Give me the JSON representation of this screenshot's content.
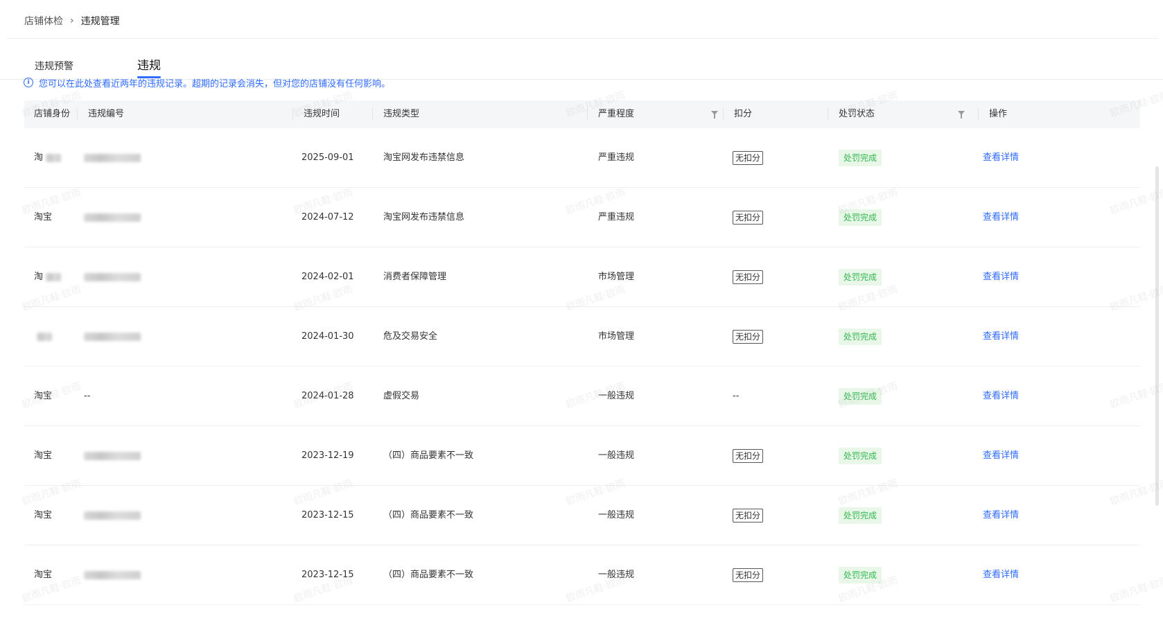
{
  "breadcrumb": {
    "parent": "店铺体检",
    "separator": "›",
    "current": "违规管理"
  },
  "tabs": [
    {
      "label": "违规预警",
      "active": false
    },
    {
      "label": "违规",
      "active": true
    }
  ],
  "notice": {
    "text": "您可以在此处查看近两年的违规记录。超期的记录会消失，但对您的店铺没有任何影响。"
  },
  "table": {
    "headers": {
      "shop_identity": "店铺身份",
      "violation_id": "违规编号",
      "violation_time": "违规时间",
      "violation_type": "违规类型",
      "severity": "严重程度",
      "deduction": "扣分",
      "penalty_status": "处罚状态",
      "action": "操作"
    },
    "rows": [
      {
        "shop": "淘",
        "shop_blur": true,
        "id": "",
        "id_blur": true,
        "time": "2025-09-01",
        "type": "淘宝网发布违禁信息",
        "severity": "严重违规",
        "deduction": "无扣分",
        "status": "处罚完成",
        "action": "查看详情"
      },
      {
        "shop": "淘宝",
        "shop_blur": false,
        "id": "",
        "id_blur": true,
        "time": "2024-07-12",
        "type": "淘宝网发布违禁信息",
        "severity": "严重违规",
        "deduction": "无扣分",
        "status": "处罚完成",
        "action": "查看详情"
      },
      {
        "shop": "淘",
        "shop_blur": true,
        "id": "",
        "id_blur": true,
        "time": "2024-02-01",
        "type": "消费者保障管理",
        "severity": "市场管理",
        "deduction": "无扣分",
        "status": "处罚完成",
        "action": "查看详情"
      },
      {
        "shop": "",
        "shop_blur": true,
        "id": "",
        "id_blur": true,
        "time": "2024-01-30",
        "type": "危及交易安全",
        "severity": "市场管理",
        "deduction": "无扣分",
        "status": "处罚完成",
        "action": "查看详情"
      },
      {
        "shop": "淘宝",
        "shop_blur": false,
        "id": "--",
        "id_blur": false,
        "time": "2024-01-28",
        "type": "虚假交易",
        "severity": "一般违规",
        "deduction": "--",
        "status": "处罚完成",
        "action": "查看详情"
      },
      {
        "shop": "淘宝",
        "shop_blur": false,
        "id": "",
        "id_blur": true,
        "time": "2023-12-19",
        "type": "（四）商品要素不一致",
        "severity": "一般违规",
        "deduction": "无扣分",
        "status": "处罚完成",
        "action": "查看详情"
      },
      {
        "shop": "淘宝",
        "shop_blur": false,
        "id": "",
        "id_blur": true,
        "time": "2023-12-15",
        "type": "（四）商品要素不一致",
        "severity": "一般违规",
        "deduction": "无扣分",
        "status": "处罚完成",
        "action": "查看详情"
      },
      {
        "shop": "淘宝",
        "shop_blur": false,
        "id": "",
        "id_blur": true,
        "time": "2023-12-15",
        "type": "（四）商品要素不一致",
        "severity": "一般违规",
        "deduction": "无扣分",
        "status": "处罚完成",
        "action": "查看详情"
      }
    ]
  },
  "watermark": "欧雨凡鞋·欧雨",
  "colors": {
    "link": "#2f6bff",
    "status_green": "#33b850",
    "status_green_bg": "#e8f7e8",
    "header_bg": "#f5f6f8"
  }
}
